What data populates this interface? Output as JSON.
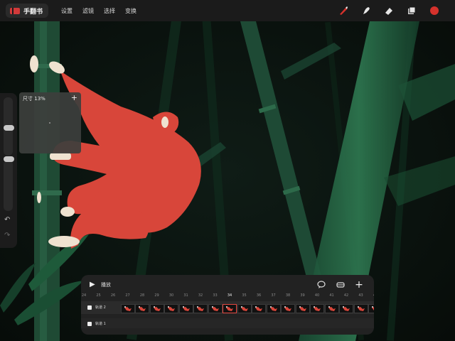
{
  "app": {
    "brand": "手翻书"
  },
  "menu": [
    "设置",
    "滤镜",
    "选择",
    "变换"
  ],
  "tools": {
    "brush_icon": "brush-icon",
    "smudge_icon": "smudge-icon",
    "eraser_icon": "eraser-icon",
    "layers_icon": "layers-icon",
    "current_color": "#d5322c"
  },
  "size_popup": {
    "label": "尺寸",
    "value": "13%"
  },
  "animation": {
    "play_label": "播放",
    "frame_numbers": [
      "24",
      "25",
      "26",
      "27",
      "28",
      "29",
      "30",
      "31",
      "32",
      "33",
      "34",
      "35",
      "36",
      "37",
      "38",
      "39",
      "40",
      "41",
      "42",
      "43",
      "44"
    ],
    "current_frame": "34",
    "tracks": [
      {
        "label": "轨道 2"
      },
      {
        "label": "轨道 1"
      }
    ]
  },
  "colors": {
    "accent": "#d5322c",
    "bamboo": "#1f5a3c",
    "figure": "#d8463a"
  }
}
